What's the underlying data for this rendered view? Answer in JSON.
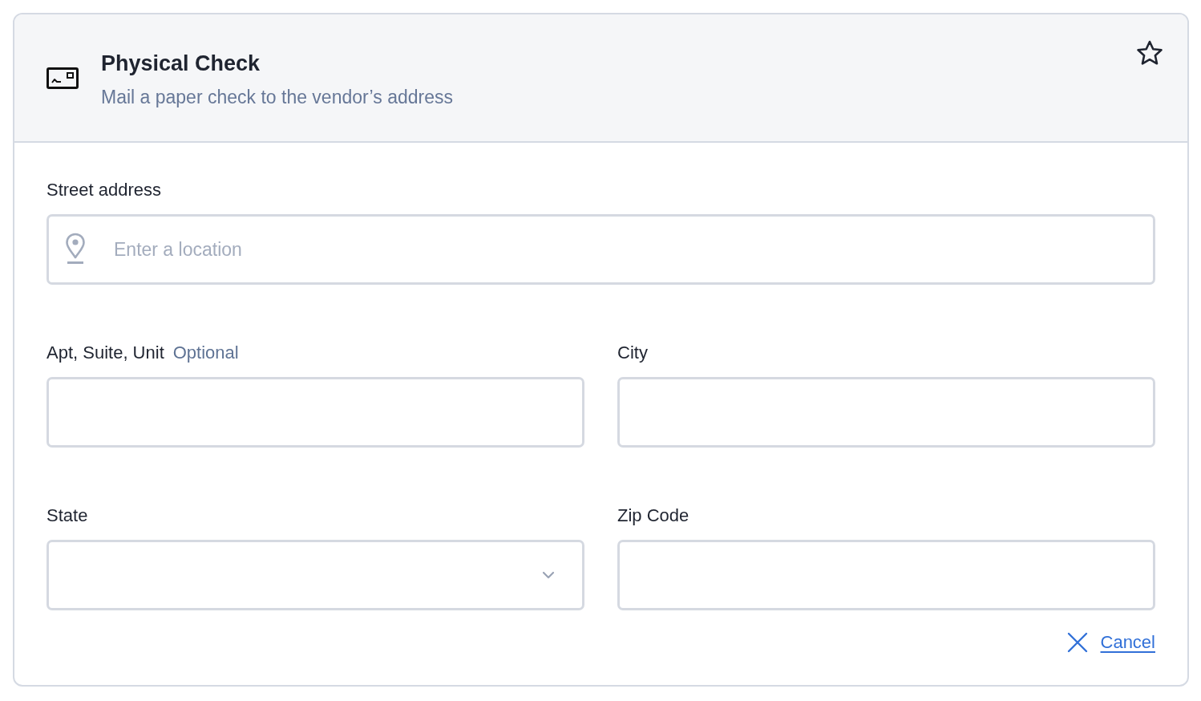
{
  "header": {
    "title": "Physical Check",
    "subtitle": "Mail a paper check to the vendor’s address"
  },
  "fields": [
    {
      "kind": "location",
      "label": "Street address",
      "placeholder": "Enter a location"
    },
    {
      "kind": "text",
      "label": "Apt, Suite, Unit",
      "hint": "Optional"
    },
    {
      "kind": "text",
      "label": "City"
    },
    {
      "kind": "select",
      "label": "State"
    },
    {
      "kind": "text",
      "label": "Zip Code"
    }
  ],
  "cancel": {
    "label": "Cancel"
  }
}
